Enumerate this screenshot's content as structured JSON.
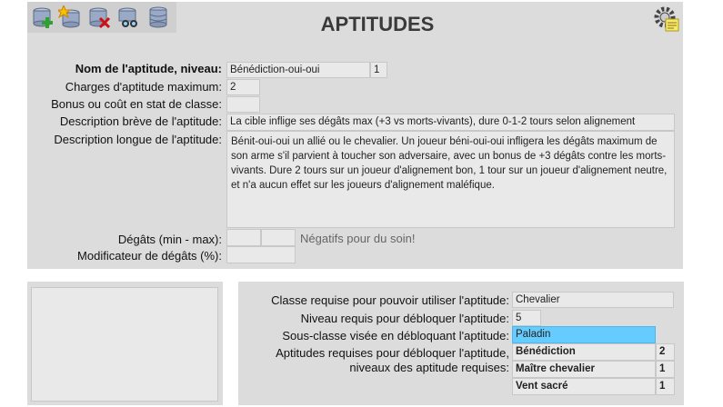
{
  "header": {
    "title": "APTITUDES",
    "toolbar": [
      {
        "name": "add-database-icon",
        "icon": "database-plus"
      },
      {
        "name": "new-database-icon",
        "icon": "database-star"
      },
      {
        "name": "delete-database-icon",
        "icon": "database-x"
      },
      {
        "name": "search-database-icon",
        "icon": "binoculars"
      },
      {
        "name": "database-stack-icon",
        "icon": "database"
      }
    ],
    "settings_icon": "gear-note"
  },
  "form": {
    "name_label": "Nom de l'aptitude, niveau:",
    "name_value": "Bénédiction-oui-oui",
    "level_value": "1",
    "max_charges_label": "Charges d'aptitude maximum:",
    "max_charges_value": "2",
    "bonus_label": "Bonus ou coût en stat de classe:",
    "bonus_value": "",
    "short_desc_label": "Description brève de l'aptitude:",
    "short_desc_value": "La cible inflige ses dégâts max (+3 vs morts-vivants), dure 0-1-2 tours selon alignement",
    "long_desc_label": "Description longue de l'aptitude:",
    "long_desc_value": "Bénit-oui-oui un allié ou le chevalier. Un joueur béni-oui-oui infligera les dégâts maximum de son arme s'il parvient à toucher son adversaire, avec un bonus de +3 dégâts contre les morts-vivants. Dure 2 tours sur un joueur d'alignement bon, 1 tour sur un joueur d'alignement neutre, et n'a aucun effet sur les joueurs d'alignement maléfique.",
    "damage_label": "Dégâts (min - max):",
    "damage_min": "",
    "damage_max": "",
    "damage_hint": "Négatifs pour du soin!",
    "damage_mod_label": "Modificateur de dégâts (%):",
    "damage_mod_value": ""
  },
  "requirements": {
    "class_label": "Classe requise pour pouvoir utiliser l'aptitude:",
    "class_value": "Chevalier",
    "level_label": "Niveau requis pour débloquer l'aptitude:",
    "level_value": "5",
    "subclass_label": "Sous-classe visée en débloquant l'aptitude:",
    "subclass_value": "Paladin",
    "prereq_label_1": "Aptitudes requises pour débloquer l'aptitude,",
    "prereq_label_2": "niveaux des aptitude requises:",
    "prereqs": [
      {
        "name": "Bénédiction",
        "level": "2"
      },
      {
        "name": "Maître chevalier",
        "level": "1"
      },
      {
        "name": "Vent sacré",
        "level": "1"
      }
    ]
  }
}
